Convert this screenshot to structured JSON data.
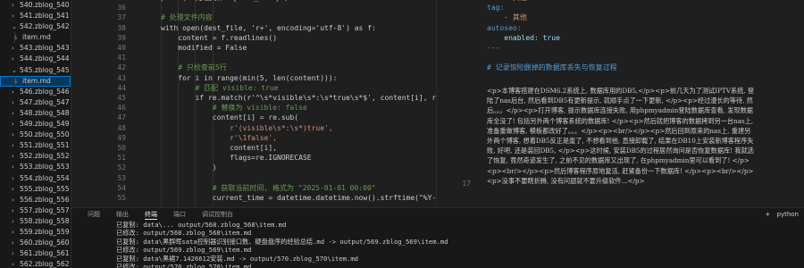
{
  "sidebar": {
    "items": [
      {
        "label": "540.zblog_540",
        "kind": "folder"
      },
      {
        "label": "541.zblog_541",
        "kind": "folder"
      },
      {
        "label": "542.zblog_542",
        "kind": "folder-open"
      },
      {
        "label": "item.md",
        "kind": "file"
      },
      {
        "label": "543.zblog_543",
        "kind": "folder"
      },
      {
        "label": "544.zblog_544",
        "kind": "folder"
      },
      {
        "label": "545.zblog_545",
        "kind": "folder-open"
      },
      {
        "label": "item.md",
        "kind": "file",
        "selected": true
      },
      {
        "label": "546.zblog_546",
        "kind": "folder"
      },
      {
        "label": "547.zblog_547",
        "kind": "folder"
      },
      {
        "label": "548.zblog_548",
        "kind": "folder"
      },
      {
        "label": "549.zblog_549",
        "kind": "folder"
      },
      {
        "label": "550.zblog_550",
        "kind": "folder"
      },
      {
        "label": "551.zblog_551",
        "kind": "folder"
      },
      {
        "label": "552.zblog_552",
        "kind": "folder"
      },
      {
        "label": "553.zblog_553",
        "kind": "folder"
      },
      {
        "label": "554.zblog_554",
        "kind": "folder"
      },
      {
        "label": "555.zblog_555",
        "kind": "folder"
      },
      {
        "label": "556.zblog_556",
        "kind": "folder"
      },
      {
        "label": "557.zblog_557",
        "kind": "folder"
      },
      {
        "label": "558.zblog_558",
        "kind": "folder"
      },
      {
        "label": "559.zblog_559",
        "kind": "folder"
      },
      {
        "label": "560.zblog_560",
        "kind": "folder"
      },
      {
        "label": "561.zblog_561",
        "kind": "folder"
      },
      {
        "label": "562.zblog_562",
        "kind": "folder"
      }
    ]
  },
  "editor": {
    "line_numbers": [
      "35",
      "36",
      "37",
      "38",
      "39",
      "40",
      "41",
      "42",
      "43",
      "44",
      "45",
      "46",
      "47",
      "48",
      "49",
      "50",
      "51",
      "52",
      "53",
      "54",
      "55"
    ],
    "code": [
      {
        "t": "print(f\"处理文件: {dest_file}\")"
      },
      {
        "t": ""
      },
      {
        "t": "# 处理文件内容"
      },
      {
        "t": "with open(dest_file, 'r+', encoding='utf-8') as f:"
      },
      {
        "t": "    content = f.readlines()"
      },
      {
        "t": "    modified = False"
      },
      {
        "t": ""
      },
      {
        "t": "    # 只检查前5行"
      },
      {
        "t": "    for i in range(min(5, len(content))):"
      },
      {
        "t": "        # 匹配 visible: true"
      },
      {
        "t": "        if re.match(r'^\\s*visible\\s*:\\s*true\\s*$', content[i], r"
      },
      {
        "t": "            # 替换为 visible: false"
      },
      {
        "t": "            content[i] = re.sub("
      },
      {
        "t": "                r'(visible\\s*:\\s*)true',"
      },
      {
        "t": "                r'\\1false',"
      },
      {
        "t": "                content[i],"
      },
      {
        "t": "                flags=re.IGNORECASE"
      },
      {
        "t": "            )"
      },
      {
        "t": ""
      },
      {
        "t": "            # 获取当前时间, 格式为 \"2025-01-01 00:00\""
      },
      {
        "t": "            current_time = datetime.datetime.now().strftime(\"%Y-"
      }
    ]
  },
  "markdown": {
    "line_numbers": [
      "17"
    ],
    "lines": [
      {
        "t": "    - 其他"
      },
      {
        "t": "tag:"
      },
      {
        "t": "    - 其他"
      },
      {
        "t": "autoseo:"
      },
      {
        "t": "    enabled: true"
      },
      {
        "t": "---"
      },
      {
        "t": ""
      },
      {
        "t": "# 记录惊险删掉的数据库丢失与恢复过程"
      }
    ],
    "paragraph": "<p>本博客搭建在DSM6.2系统上, 数据库用的DB5,</p><p>前几天为了测试IPTV系统, 登陆了nas后台, 然后看到DB5有更新提示, 就顺手点了一下更新, </p><p>经过漫长的等待, 然后。。。</p><p>打开博客, 提示数据库连接失败, 用phpmyadmin登陆数据库查看, 发现数据库全没了! 包括另外两个博客系统的数据库! </p><p>然后就把博客的数据拷到另一台nas上, 准备重做博客, 模板都改好了。。。</p><p><br/></p><p>然后回到原来的nas上, 重建另外两个博客, 想着DB5反正是废了, 不想看到他, 直接卸载了, 结果在DB10上安装新博客程序失败, 好吧, 还是装回DB5, </p><p>这时候, 安装DB5的过程居然询问是否恢复数据库! 我就选了恢复, 竟然奇迹发生了, 之前不见的数据库又出现了, 在phpmyadmin里可以看到了! </p><p><br/></p><p>然后博客程序原地复活, 赶紧备份一下数据库! </p><p><br/></p><p>没事不要瞎折腾, 没有问题就不要升级软件...</p>"
  },
  "panel": {
    "tabs": [
      "问题",
      "输出",
      "终端",
      "端口",
      "调试控制台"
    ],
    "active_tab": "终端",
    "tools": [
      "+",
      "python"
    ],
    "terminal_lines": [
      "已复制: data\\... output/568.zblog_568\\item.md",
      "已修改: output/568.zblog_568\\item.md",
      "已复制: data\\黑群晖sata控制器识别接口数、硬盘盘序的经验总结.md -> output/569.zblog_569\\item.md",
      "已修改: output/569.zblog_569\\item.md",
      "已复制: data\\黑裙7.1426612安装.md -> output/570.zblog_570\\item.md",
      "已修改: output/570.zblog_570\\item.md"
    ]
  }
}
